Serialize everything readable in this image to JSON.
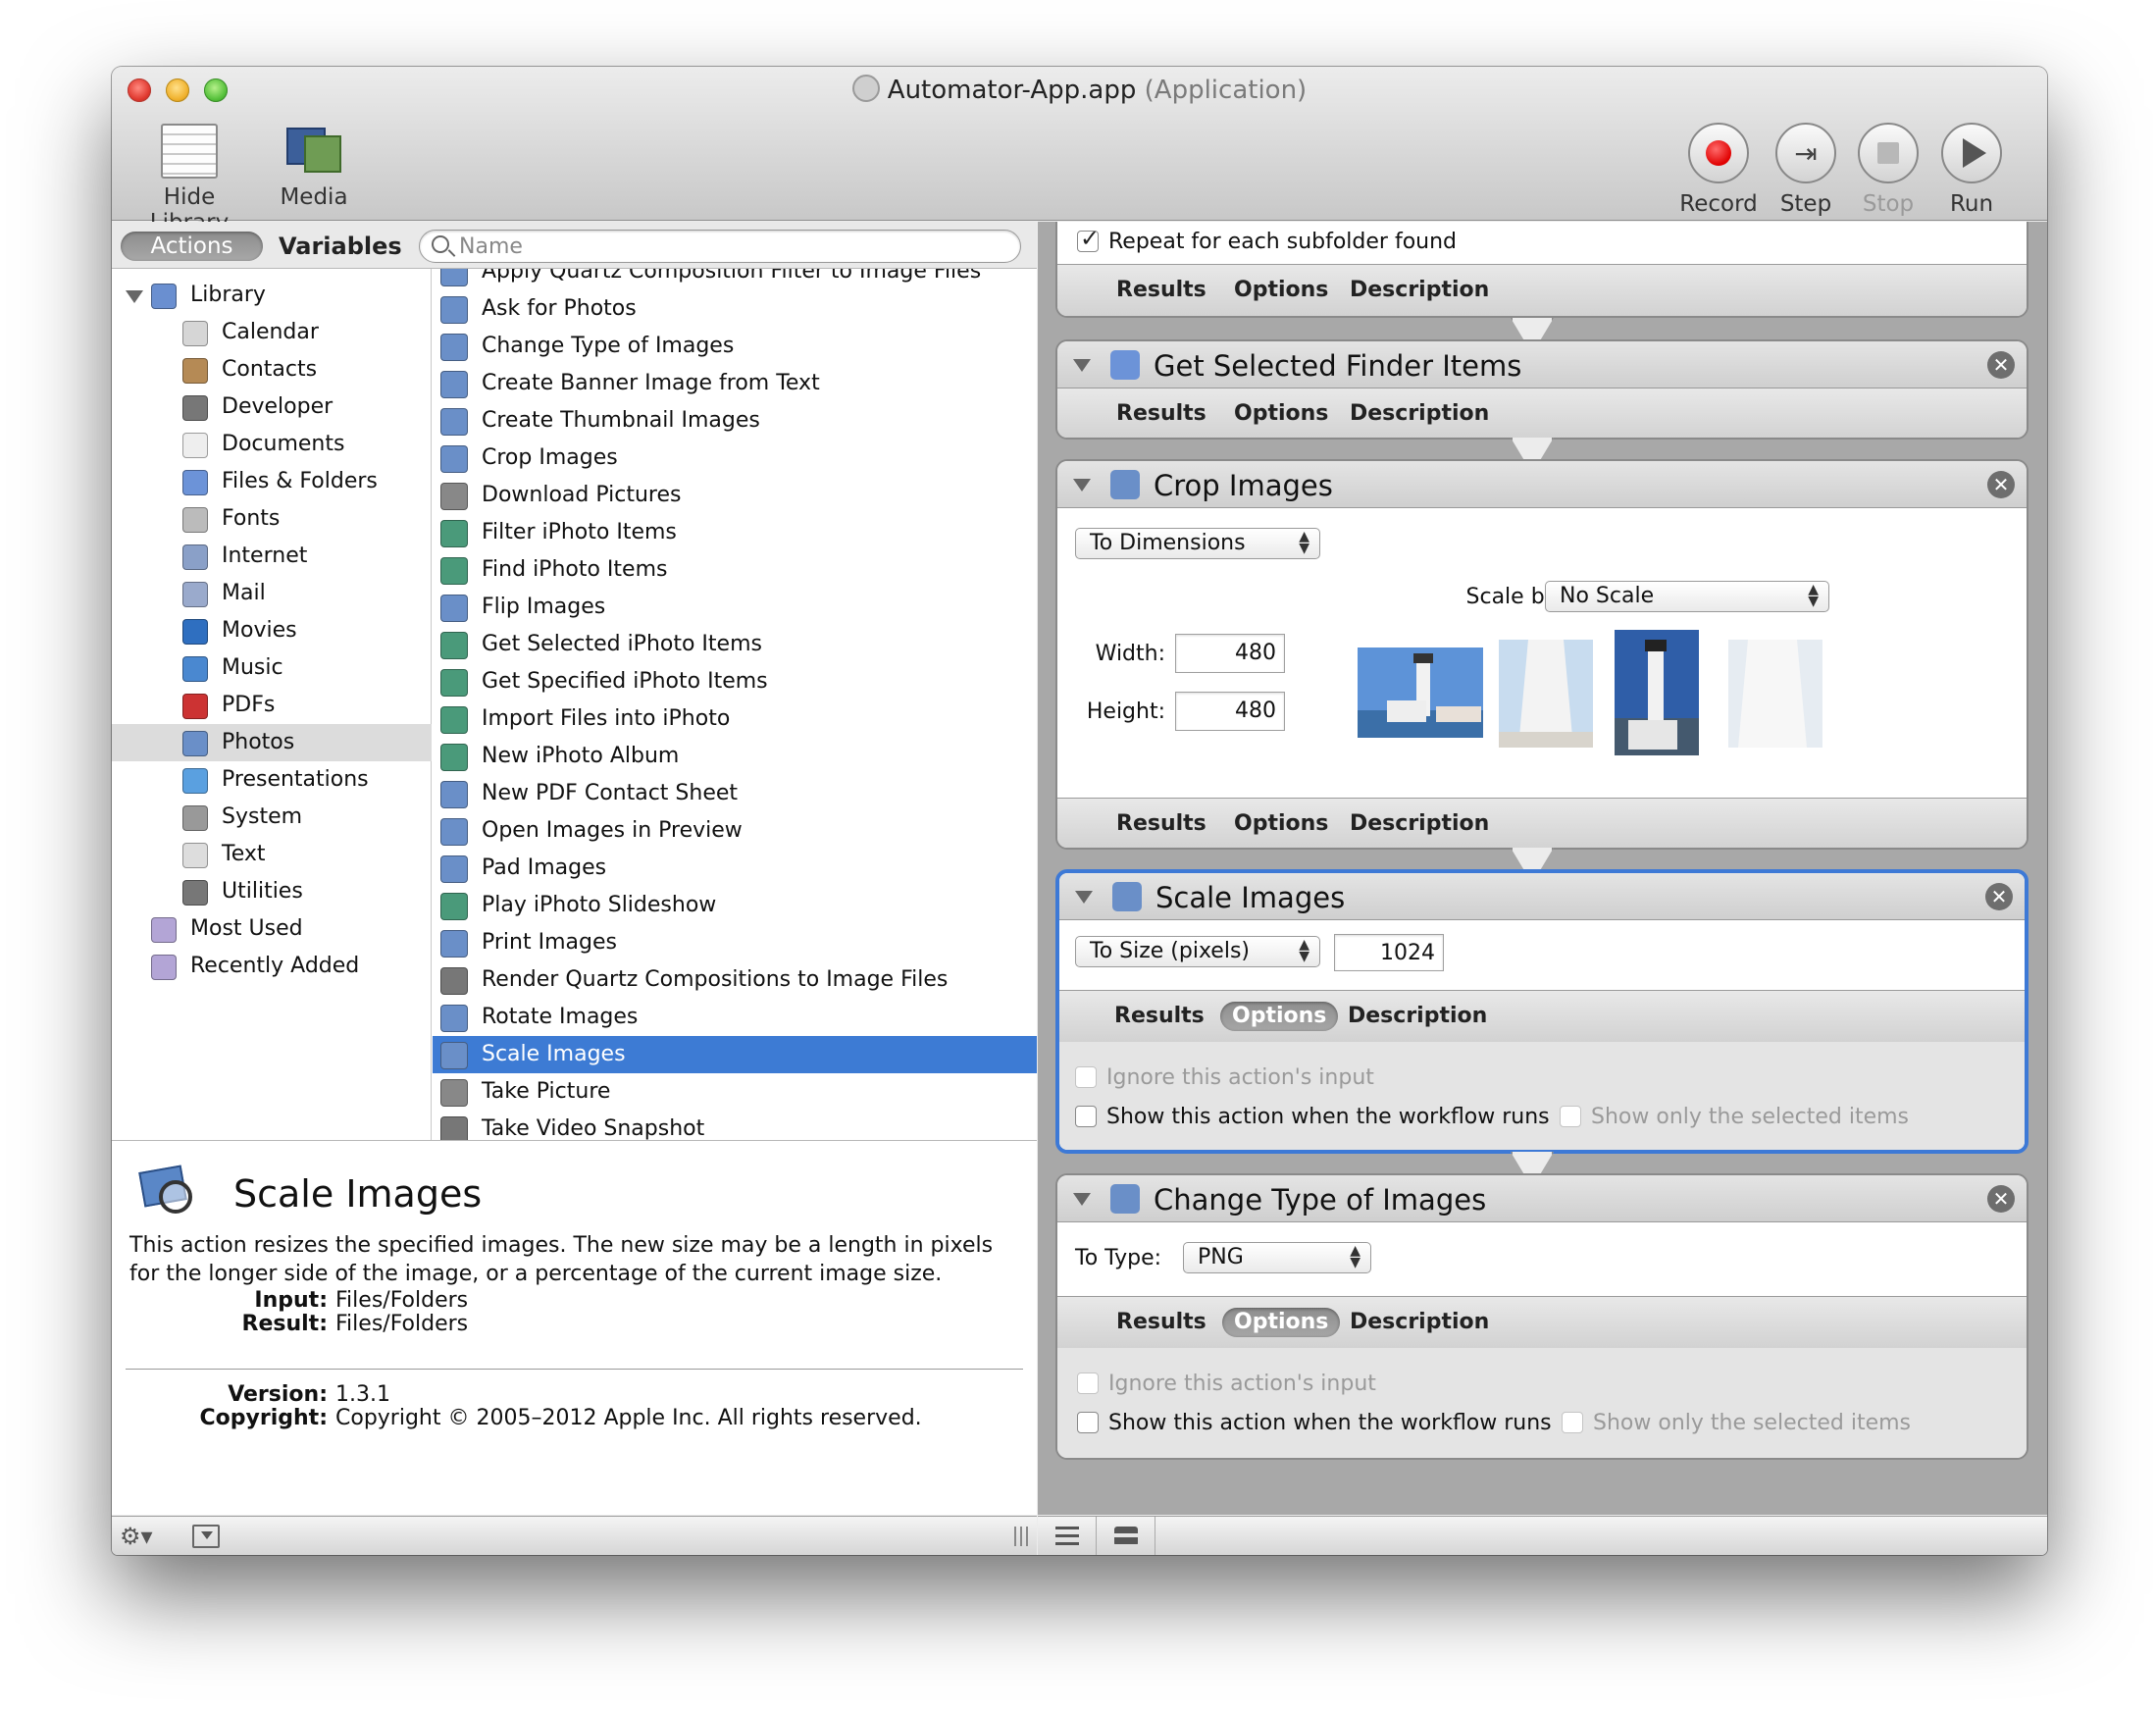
{
  "window": {
    "title": "Automator-App.app",
    "title_sub": "(Application)"
  },
  "toolbar": {
    "hide_library": "Hide Library",
    "media": "Media",
    "record": "Record",
    "step": "Step",
    "stop": "Stop",
    "run": "Run"
  },
  "library_tabs": {
    "actions": "Actions",
    "variables": "Variables",
    "search_placeholder": "Name"
  },
  "categories": [
    {
      "label": "Library",
      "icon": "library-icon",
      "color": "#6a8fd0",
      "level": 0
    },
    {
      "label": "Calendar",
      "icon": "calendar-icon",
      "color": "#d6d6d6",
      "level": 1
    },
    {
      "label": "Contacts",
      "icon": "contacts-icon",
      "color": "#b58a55",
      "level": 1
    },
    {
      "label": "Developer",
      "icon": "developer-icon",
      "color": "#777777",
      "level": 1
    },
    {
      "label": "Documents",
      "icon": "documents-icon",
      "color": "#eeeeee",
      "level": 1
    },
    {
      "label": "Files & Folders",
      "icon": "finder-icon",
      "color": "#6c93d8",
      "level": 1
    },
    {
      "label": "Fonts",
      "icon": "fonts-icon",
      "color": "#bbbbbb",
      "level": 1
    },
    {
      "label": "Internet",
      "icon": "internet-icon",
      "color": "#8aa0c8",
      "level": 1
    },
    {
      "label": "Mail",
      "icon": "mail-icon",
      "color": "#9aaacc",
      "level": 1
    },
    {
      "label": "Movies",
      "icon": "movies-icon",
      "color": "#2f6fc0",
      "level": 1
    },
    {
      "label": "Music",
      "icon": "music-icon",
      "color": "#4a88d0",
      "level": 1
    },
    {
      "label": "PDFs",
      "icon": "pdf-icon",
      "color": "#cc3333",
      "level": 1
    },
    {
      "label": "Photos",
      "icon": "photos-icon",
      "color": "#6a8fc8",
      "level": 1
    },
    {
      "label": "Presentations",
      "icon": "presentations-icon",
      "color": "#5aa0e0",
      "level": 1
    },
    {
      "label": "System",
      "icon": "system-icon",
      "color": "#999999",
      "level": 1
    },
    {
      "label": "Text",
      "icon": "text-icon",
      "color": "#dddddd",
      "level": 1
    },
    {
      "label": "Utilities",
      "icon": "utilities-icon",
      "color": "#777777",
      "level": 1
    },
    {
      "label": "Most Used",
      "icon": "smart-folder-icon",
      "color": "#b3a5d6",
      "level": 0
    },
    {
      "label": "Recently Added",
      "icon": "smart-folder-icon",
      "color": "#b3a5d6",
      "level": 0
    }
  ],
  "selected_category": "Photos",
  "actions": [
    {
      "label": "Apply Quartz Composition Filter to Image Files",
      "icon": "photos-action-icon",
      "color": "#6a8fc8"
    },
    {
      "label": "Ask for Photos",
      "icon": "photos-action-icon",
      "color": "#6a8fc8"
    },
    {
      "label": "Change Type of Images",
      "icon": "photos-action-icon",
      "color": "#6a8fc8"
    },
    {
      "label": "Create Banner Image from Text",
      "icon": "photos-action-icon",
      "color": "#6a8fc8"
    },
    {
      "label": "Create Thumbnail Images",
      "icon": "photos-action-icon",
      "color": "#6a8fc8"
    },
    {
      "label": "Crop Images",
      "icon": "photos-action-icon",
      "color": "#6a8fc8"
    },
    {
      "label": "Download Pictures",
      "icon": "camera-icon",
      "color": "#888888"
    },
    {
      "label": "Filter iPhoto Items",
      "icon": "iphoto-icon",
      "color": "#4a9a7a"
    },
    {
      "label": "Find iPhoto Items",
      "icon": "iphoto-icon",
      "color": "#4a9a7a"
    },
    {
      "label": "Flip Images",
      "icon": "photos-action-icon",
      "color": "#6a8fc8"
    },
    {
      "label": "Get Selected iPhoto Items",
      "icon": "iphoto-icon",
      "color": "#4a9a7a"
    },
    {
      "label": "Get Specified iPhoto Items",
      "icon": "iphoto-icon",
      "color": "#4a9a7a"
    },
    {
      "label": "Import Files into iPhoto",
      "icon": "iphoto-icon",
      "color": "#4a9a7a"
    },
    {
      "label": "New iPhoto Album",
      "icon": "iphoto-icon",
      "color": "#4a9a7a"
    },
    {
      "label": "New PDF Contact Sheet",
      "icon": "photos-action-icon",
      "color": "#6a8fc8"
    },
    {
      "label": "Open Images in Preview",
      "icon": "photos-action-icon",
      "color": "#6a8fc8"
    },
    {
      "label": "Pad Images",
      "icon": "photos-action-icon",
      "color": "#6a8fc8"
    },
    {
      "label": "Play iPhoto Slideshow",
      "icon": "iphoto-icon",
      "color": "#4a9a7a"
    },
    {
      "label": "Print Images",
      "icon": "photos-action-icon",
      "color": "#6a8fc8"
    },
    {
      "label": "Render Quartz Compositions to Image Files",
      "icon": "tools-icon",
      "color": "#777777"
    },
    {
      "label": "Rotate Images",
      "icon": "photos-action-icon",
      "color": "#6a8fc8"
    },
    {
      "label": "Scale Images",
      "icon": "photos-action-icon",
      "color": "#6a8fc8"
    },
    {
      "label": "Take Picture",
      "icon": "camera-icon",
      "color": "#888888"
    },
    {
      "label": "Take Video Snapshot",
      "icon": "tools-icon",
      "color": "#777777"
    }
  ],
  "selected_action": "Scale Images",
  "description": {
    "title": "Scale Images",
    "text": "This action resizes the specified images. The new size may be a length in pixels for the longer side of the image, or a percentage of the current image size.",
    "input_label": "Input:",
    "input_value": "Files/Folders",
    "result_label": "Result:",
    "result_value": "Files/Folders",
    "version_label": "Version:",
    "version_value": "1.3.1",
    "copyright_label": "Copyright:",
    "copyright_value": "Copyright © 2005–2012 Apple Inc.  All rights reserved."
  },
  "workflow": {
    "tab_results": "Results",
    "tab_options": "Options",
    "tab_description": "Description",
    "top_card": {
      "repeat_label": "Repeat for each subfolder found",
      "repeat_checked": true
    },
    "finder_card": {
      "title": "Get Selected Finder Items"
    },
    "crop_card": {
      "title": "Crop Images",
      "mode": "To Dimensions",
      "scale_label": "Scale before crop:",
      "scale_value": "No Scale",
      "width_label": "Width:",
      "width_value": "480",
      "height_label": "Height:",
      "height_value": "480"
    },
    "scale_card": {
      "title": "Scale Images",
      "mode": "To Size (pixels)",
      "size_value": "1024",
      "ignore_input": "Ignore this action's input",
      "show_when_runs": "Show this action when the workflow runs",
      "show_only_selected": "Show only the selected items"
    },
    "change_type_card": {
      "title": "Change Type of Images",
      "to_type_label": "To Type:",
      "to_type_value": "PNG",
      "ignore_input": "Ignore this action's input",
      "show_when_runs": "Show this action when the workflow runs",
      "show_only_selected": "Show only the selected items"
    }
  },
  "colors": {
    "selection": "#3d7bd4",
    "active_card_border": "#3d79d6",
    "record_red": "#e00000"
  }
}
